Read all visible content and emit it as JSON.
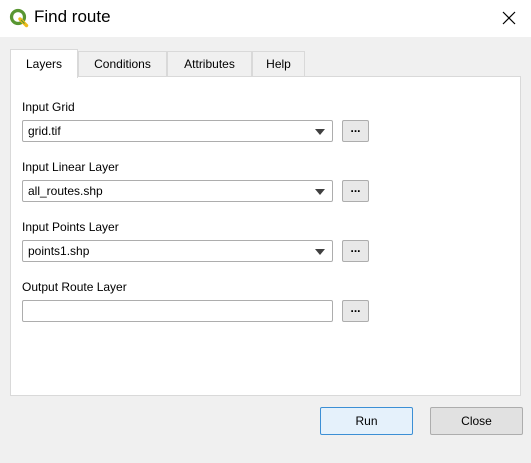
{
  "window": {
    "title": "Find route",
    "app_icon": "qgis-logo-icon",
    "close_icon": "close-icon"
  },
  "tabs": [
    {
      "label": "Layers",
      "active": true
    },
    {
      "label": "Conditions",
      "active": false
    },
    {
      "label": "Attributes",
      "active": false
    },
    {
      "label": "Help",
      "active": false
    }
  ],
  "layers": {
    "input_grid": {
      "label": "Input Grid",
      "value": "grid.tif",
      "browse_label": "..."
    },
    "input_linear": {
      "label": "Input Linear Layer",
      "value": "all_routes.shp",
      "browse_label": "..."
    },
    "input_points": {
      "label": "Input Points Layer",
      "value": "points1.shp",
      "browse_label": "..."
    },
    "output_route": {
      "label": "Output Route Layer",
      "value": "",
      "browse_label": "..."
    }
  },
  "buttons": {
    "run": "Run",
    "close": "Close"
  },
  "colors": {
    "accent_border": "#3c8fd5",
    "qgis_green": "#589632",
    "qgis_yellow": "#eebb1c"
  }
}
